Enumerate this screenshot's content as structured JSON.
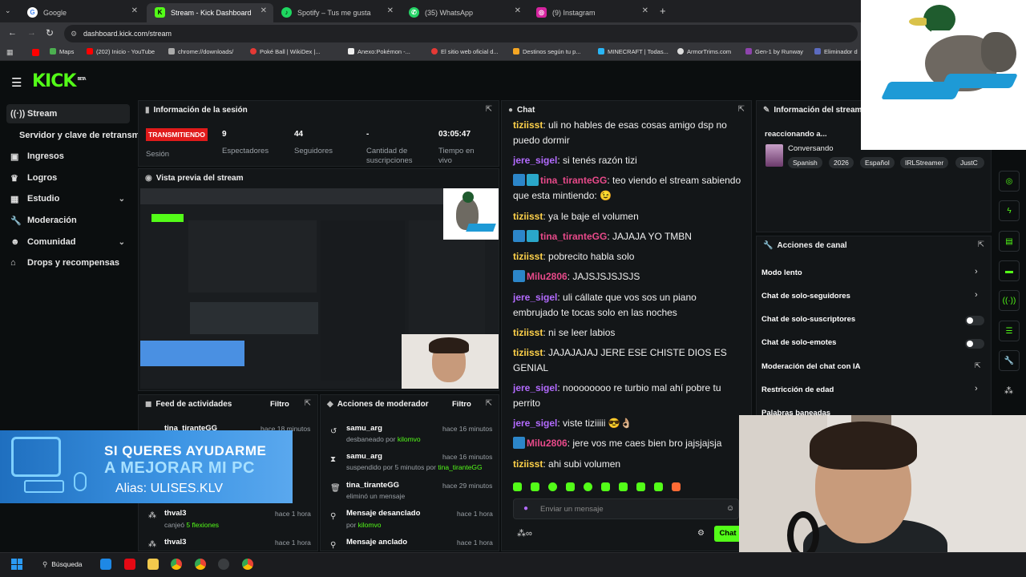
{
  "browser": {
    "tabs": [
      {
        "title": "Google",
        "active": false
      },
      {
        "title": "Stream - Kick Dashboard",
        "active": true
      },
      {
        "title": "Spotify – Tus me gusta",
        "active": false
      },
      {
        "title": "(35) WhatsApp",
        "active": false
      },
      {
        "title": "(9) Instagram",
        "active": false
      }
    ],
    "url": "dashboard.kick.com/stream",
    "bookmarks": [
      "Maps",
      "(202) Inicio - YouTube",
      "chrome://downloads/",
      "Poké Ball | WikiDex |...",
      "Anexo:Pokémon -...",
      "El sitio web oficial d...",
      "Destinos según tu p...",
      "MINECRAFT | Todas...",
      "ArmorTrims.com",
      "Gen-1 by Runway",
      "Eliminador d"
    ]
  },
  "kick": {
    "logo": "KICK",
    "beta": "BETA"
  },
  "sidebar": {
    "items": [
      {
        "label": "Stream"
      },
      {
        "label": "Servidor y clave de retransm"
      },
      {
        "label": "Ingresos"
      },
      {
        "label": "Logros"
      },
      {
        "label": "Estudio"
      },
      {
        "label": "Moderación"
      },
      {
        "label": "Comunidad"
      },
      {
        "label": "Drops y recompensas"
      }
    ]
  },
  "session": {
    "title": "Información de la sesión",
    "status": "TRANSMITIENDO",
    "status_label": "Sesión",
    "stats": [
      {
        "value": "9",
        "label": "Espectadores"
      },
      {
        "value": "44",
        "label": "Seguidores"
      },
      {
        "value": "-",
        "label": "Cantidad de suscripciones"
      },
      {
        "value": "03:05:47",
        "label": "Tiempo en vivo"
      }
    ]
  },
  "preview": {
    "title": "Vista previa del stream"
  },
  "overlay": {
    "line1": "SI QUERES AYUDARME",
    "line2": "A MEJORAR MI PC",
    "line3": "Alias: ULISES.KLV"
  },
  "feed": {
    "title": "Feed de actividades",
    "filter": "Filtro",
    "rows": [
      {
        "name": "tina_tiranteGG",
        "time": "hace 18 minutos",
        "sub": ""
      },
      {
        "name": "thval3",
        "time": "hace 1 hora",
        "sub_pre": "canjeó ",
        "sub_hl": "5 flexiones"
      },
      {
        "name": "thval3",
        "time": "hace 1 hora",
        "sub": ""
      }
    ]
  },
  "modactions": {
    "title": "Acciones de moderador",
    "filter": "Filtro",
    "rows": [
      {
        "name": "samu_arg",
        "time": "hace 16 minutos",
        "sub_pre": "desbaneado por ",
        "sub_hl": "kilomvo"
      },
      {
        "name": "samu_arg",
        "time": "hace 16 minutos",
        "sub_pre": "suspendido por 5 minutos por ",
        "sub_hl": "tina_tiranteGG"
      },
      {
        "name": "tina_tiranteGG",
        "time": "hace 29 minutos",
        "sub_pre": "eliminó un mensaje",
        "sub_hl": ""
      },
      {
        "name": "Mensaje desanclado",
        "time": "hace 1 hora",
        "sub_pre": "por ",
        "sub_hl": "kilomvo"
      },
      {
        "name": "Mensaje anclado",
        "time": "hace 1 hora",
        "sub_pre": "",
        "sub_hl": ""
      }
    ]
  },
  "chat": {
    "title": "Chat",
    "messages": [
      {
        "user": "tiziisst",
        "color": "#ffd24a",
        "text": "uli no hables de esas cosas amigo dsp no puedo dormir",
        "badges": 0
      },
      {
        "user": "jere_sigel",
        "color": "#b36bff",
        "text": "si tenés razón tizi",
        "badges": 0
      },
      {
        "user": "tina_tiranteGG",
        "color": "#e84a8a",
        "text": "teo viendo el stream sabiendo que esta mintiendo: 😉",
        "badges": 2
      },
      {
        "user": "tiziisst",
        "color": "#ffd24a",
        "text": "ya le baje el volumen",
        "badges": 0
      },
      {
        "user": "tina_tiranteGG",
        "color": "#e84a8a",
        "text": "JAJAJA YO TMBN",
        "badges": 2
      },
      {
        "user": "tiziisst",
        "color": "#ffd24a",
        "text": "pobrecito habla solo",
        "badges": 0
      },
      {
        "user": "Milu2806",
        "color": "#e84a8a",
        "text": "JAJSJSJSJSJS",
        "badges": 1
      },
      {
        "user": "jere_sigel",
        "color": "#b36bff",
        "text": "uli cállate que vos sos un piano embrujado te tocas solo en las noches",
        "badges": 0
      },
      {
        "user": "tiziisst",
        "color": "#ffd24a",
        "text": "ni se leer labios",
        "badges": 0
      },
      {
        "user": "tiziisst",
        "color": "#ffd24a",
        "text": "JAJAJAJAJ JERE ESE CHISTE DIOS ES GENIAL",
        "badges": 0
      },
      {
        "user": "jere_sigel",
        "color": "#b36bff",
        "text": "noooooooo re turbio mal ahí pobre tu perrito",
        "badges": 0
      },
      {
        "user": "jere_sigel",
        "color": "#b36bff",
        "text": "viste tiziiiii 😎👌🏼",
        "badges": 0
      },
      {
        "user": "Milu2806",
        "color": "#e84a8a",
        "text": "jere vos me caes bien bro jajsjajsja",
        "badges": 1
      },
      {
        "user": "tiziisst",
        "color": "#ffd24a",
        "text": "ahi subi volumen",
        "badges": 0
      }
    ],
    "input_placeholder": "Enviar un mensaje",
    "send_label": "Chat"
  },
  "streaminfo": {
    "title": "Información del stream",
    "stream_title": "reaccionando a...",
    "category": "Conversando",
    "tags": [
      "Spanish",
      "2026",
      "Español",
      "IRLStreamer",
      "JustC"
    ]
  },
  "channelactions": {
    "title": "Acciones de canal",
    "items": [
      {
        "label": "Modo lento",
        "control": "chevron"
      },
      {
        "label": "Chat de solo-seguidores",
        "control": "chevron"
      },
      {
        "label": "Chat de solo-suscriptores",
        "control": "toggle"
      },
      {
        "label": "Chat de solo-emotes",
        "control": "toggle"
      },
      {
        "label": "Moderación del chat con IA",
        "control": "external"
      },
      {
        "label": "Restricción de edad",
        "control": "chevron"
      },
      {
        "label": "Palabras baneadas",
        "control": "chevron"
      }
    ]
  },
  "taskbar": {
    "search": "Búsqueda"
  },
  "colors": {
    "accent": "#53fc18",
    "live": "#e01b1b",
    "bg": "#0b0e0f",
    "panel": "#131618"
  }
}
